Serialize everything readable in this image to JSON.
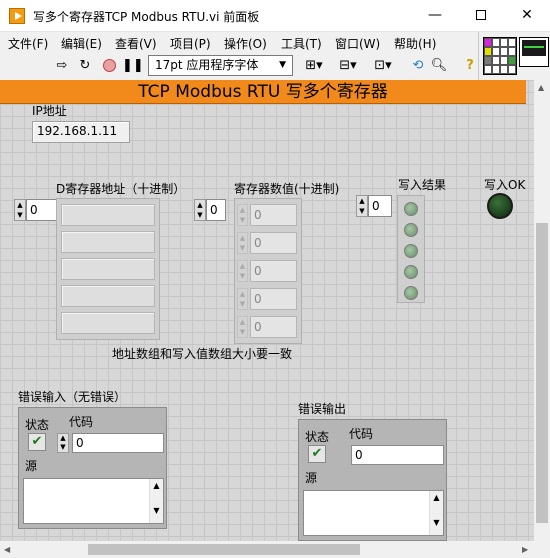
{
  "window": {
    "title": "写多个寄存器TCP Modbus RTU.vi 前面板",
    "minimize": "—",
    "close": "✕"
  },
  "menu": [
    "文件(F)",
    "编辑(E)",
    "查看(V)",
    "项目(P)",
    "操作(O)",
    "工具(T)",
    "窗口(W)",
    "帮助(H)"
  ],
  "toolbar": {
    "font": "17pt 应用程序字体",
    "icons": [
      "run-arrow-icon",
      "run-continuous-icon",
      "abort-icon",
      "pause-icon",
      "align-icon",
      "distribute-icon",
      "resize-icon",
      "reorder-icon",
      "search-icon",
      "help-icon"
    ]
  },
  "panel": {
    "banner": "TCP Modbus RTU 写多个寄存器",
    "ip_label": "IP地址",
    "ip_value": "192.168.1.11",
    "addr_label": "D寄存器地址（十进制）",
    "addr_index": "0",
    "values_label": "寄存器数值(十进制)",
    "values_index": "0",
    "values": [
      "0",
      "0",
      "0",
      "0",
      "0"
    ],
    "result_label": "写入结果",
    "result_index": "0",
    "ok_label": "写入OK",
    "note": "地址数组和写入值数组大小要一致",
    "error_in": {
      "title": "错误输入（无错误）",
      "status_label": "状态",
      "code_label": "代码",
      "code_value": "0",
      "source_label": "源"
    },
    "error_out": {
      "title": "错误输出",
      "status_label": "状态",
      "code_label": "代码",
      "code_value": "0",
      "source_label": "源"
    }
  },
  "colors": {
    "banner": "#f28a1b",
    "led_off": "#6a8a6a",
    "ok_led": "#0b2a0b"
  }
}
